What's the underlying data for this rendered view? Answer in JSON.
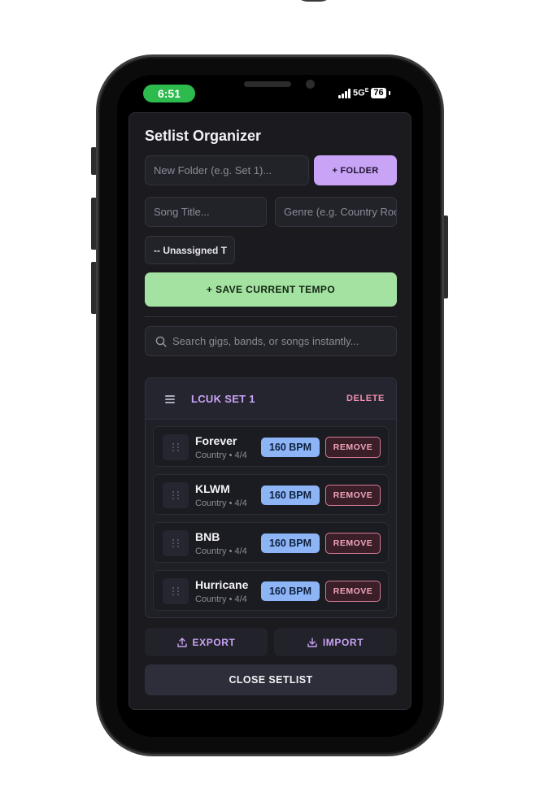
{
  "status_bar": {
    "time": "6:51",
    "network": "5G",
    "network_sup": "E",
    "battery": "76"
  },
  "app": {
    "title": "Setlist Organizer",
    "folder_input_placeholder": "New Folder (e.g. Set 1)...",
    "folder_button": "+ FOLDER",
    "song_title_placeholder": "Song Title...",
    "genre_placeholder": "Genre (e.g. Country Rock)",
    "folder_select": "-- Unassigned T",
    "save_button": "+ SAVE CURRENT TEMPO",
    "search_placeholder": "Search gigs, bands, or songs instantly...",
    "folders": [
      {
        "name": "LCUK SET 1",
        "delete_label": "DELETE",
        "songs": [
          {
            "title": "Forever",
            "meta": "Country • 4/4",
            "bpm": "160 BPM",
            "remove_label": "REMOVE"
          },
          {
            "title": "KLWM",
            "meta": "Country • 4/4",
            "bpm": "160 BPM",
            "remove_label": "REMOVE"
          },
          {
            "title": "BNB",
            "meta": "Country • 4/4",
            "bpm": "160 BPM",
            "remove_label": "REMOVE"
          },
          {
            "title": "Hurricane",
            "meta": "Country • 4/4",
            "bpm": "160 BPM",
            "remove_label": "REMOVE"
          }
        ]
      }
    ],
    "export_button": "EXPORT",
    "import_button": "IMPORT",
    "close_button": "CLOSE SETLIST"
  },
  "colors": {
    "accent_purple": "#c9a3f5",
    "save_green": "#a3e2a0",
    "bpm_blue": "#8db5f6",
    "remove_pink": "#d27a93",
    "status_green": "#2dbb4e"
  }
}
